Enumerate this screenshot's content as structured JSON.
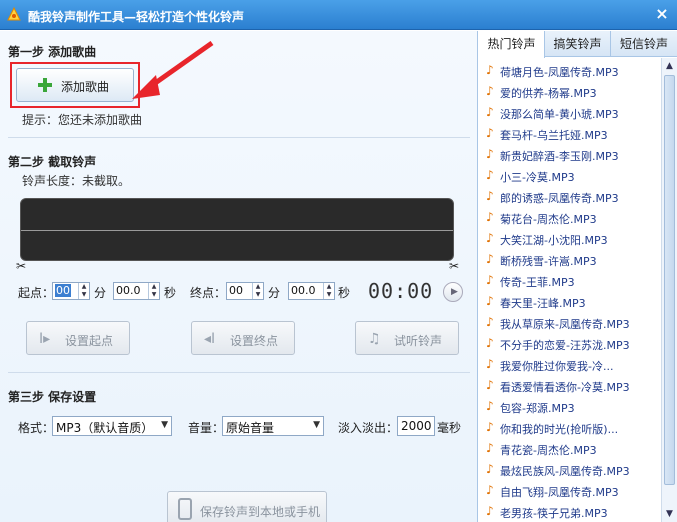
{
  "window": {
    "title": "酷我铃声制作工具—轻松打造个性化铃声",
    "close": "×"
  },
  "step1": {
    "title": "第一步 添加歌曲",
    "add_button": "添加歌曲",
    "hint": "提示：您还未添加歌曲"
  },
  "step2": {
    "title": "第二步 截取铃声",
    "length_label": "铃声长度：未截取。",
    "start_label": "起点：",
    "end_label": "终点：",
    "min_unit": "分",
    "sec_unit": "秒",
    "start_min": "00",
    "start_sec": "00.0",
    "end_min": "00",
    "end_sec": "00.0",
    "timer": "00:00",
    "set_start": "设置起点",
    "set_end": "设置终点",
    "preview": "试听铃声"
  },
  "step3": {
    "title": "第三步 保存设置",
    "format_label": "格式：",
    "format_value": "MP3（默认音质）",
    "volume_label": "音量：",
    "volume_value": "原始音量",
    "fade_label": "淡入淡出：",
    "fade_value": "2000",
    "fade_unit": "毫秒",
    "save_button": "保存铃声到本地或手机"
  },
  "tabs": [
    {
      "label": "热门铃声",
      "active": true
    },
    {
      "label": "搞笑铃声"
    },
    {
      "label": "短信铃声"
    }
  ],
  "songs": [
    "荷塘月色-凤凰传奇.MP3",
    "爱的供养-杨幂.MP3",
    "没那么简单-黄小琥.MP3",
    "套马杆-乌兰托娅.MP3",
    "新贵妃醉酒-李玉刚.MP3",
    "小三-冷莫.MP3",
    "郎的诱惑-凤凰传奇.MP3",
    "菊花台-周杰伦.MP3",
    "大笑江湖-小沈阳.MP3",
    "断桥残雪-许嵩.MP3",
    "传奇-王菲.MP3",
    "春天里-汪峰.MP3",
    "我从草原来-凤凰传奇.MP3",
    "不分手的恋爱-汪苏泷.MP3",
    "我爱你胜过你爱我-冷...",
    "看透爱情看透你-冷莫.MP3",
    "包容-郑源.MP3",
    "你和我的时光(抢听版)...",
    "青花瓷-周杰伦.MP3",
    "最炫民族风-凤凰传奇.MP3",
    "自由飞翔-凤凰传奇.MP3",
    "老男孩-筷子兄弟.MP3"
  ],
  "colors": {
    "accent": "#2b7fd0",
    "highlight": "#e8252b",
    "song_link": "#1f3a8a",
    "note": "#e07000"
  }
}
